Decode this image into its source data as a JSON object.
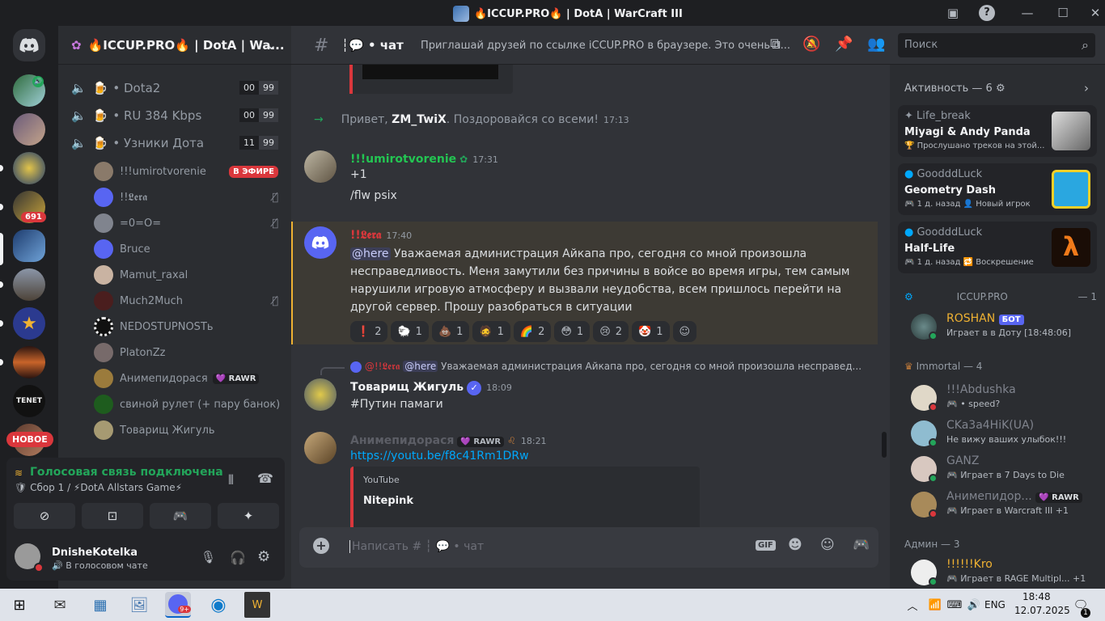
{
  "window": {
    "title": "🔥ICCUP.PRO🔥 | DotA | WarCraft III"
  },
  "colors": {
    "accent": "#5865f2",
    "live": "#da373c",
    "online": "#23a55a",
    "dnd": "#da373c",
    "mention_bg": "#3c3e57"
  },
  "guilds": {
    "badge_count": "691",
    "new_label": "НОВОЕ",
    "tenet_label": "TENET"
  },
  "server": {
    "name": "🔥ICCUP.PRO🔥 | DotA | Wa..."
  },
  "voice_channels": [
    {
      "name": "Dota2",
      "left": "00",
      "right": "99"
    },
    {
      "name": "RU 384 Kbps",
      "left": "00",
      "right": "99"
    },
    {
      "name": "Узники Дота",
      "left": "11",
      "right": "99"
    }
  ],
  "voice_users": [
    {
      "name": "!!!umirotvorenie",
      "live": "В ЭФИРЕ"
    },
    {
      "name": "!!𝕷𝖊𝖗𝖆"
    },
    {
      "name": "=0=O="
    },
    {
      "name": "Bruce"
    },
    {
      "name": "Mamut_raxal"
    },
    {
      "name": "Much2Much"
    },
    {
      "name": "NEDOSTUPNOSTь"
    },
    {
      "name": "PlatonZz"
    },
    {
      "name": "Анимепидорася",
      "tag": "RAWR"
    },
    {
      "name": "свиной рулет (+ пару банок)"
    },
    {
      "name": "Товарищ Жигуль"
    }
  ],
  "voice_panel": {
    "status": "Голосовая связь подключена",
    "channel": "Сбор 1 / ⚡DotA Allstars Game⚡"
  },
  "user_panel": {
    "name": "DnisheKotelka",
    "status": "В голосовом чате"
  },
  "chat_header": {
    "channel": "• чат",
    "topic": "Приглашай друзей по ссылке iCCUP.PRO в браузере. Это очень п...",
    "search_placeholder": "Поиск"
  },
  "system_msg": {
    "prefix": "Привет, ",
    "user": "ZM_TwiX",
    "suffix": ". Поздоровайся со всеми!",
    "time": "17:13"
  },
  "messages": [
    {
      "author": "!!!umirotvorenie",
      "time": "17:31",
      "lines": [
        "+1",
        "/flw psix"
      ]
    },
    {
      "author": "!!𝕷𝖊𝖗𝖆",
      "time": "17:40",
      "mention": "@here",
      "text": "Уважаемая администрация Айкапа про, сегодня со мной произошла несправедливость. Меня замутили без причины в войсе во время игры, тем самым нарушили игровую атмосферу и вызвали неудобства, всем пришлось перейти на другой сервер. Прошу разобраться в ситуации"
    },
    {
      "author": "Товарищ Жигуль",
      "time": "18:09",
      "reply_author": "@!!𝕷𝖊𝖗𝖆",
      "reply_mention": "@here",
      "reply_text": "Уважаемая администрация Айкапа про, сегодня со мной произошла несправед...",
      "text": "#Путин памаги"
    },
    {
      "author": "Анимепидорася",
      "tag": "RAWR",
      "time": "18:21",
      "link": "https://youtu.be/f8c41Rm1DRw",
      "embed_provider": "YouTube",
      "embed_author": "Nitepink"
    }
  ],
  "reactions": [
    {
      "emoji": "❗",
      "count": "2"
    },
    {
      "emoji": "🐑",
      "count": "1"
    },
    {
      "emoji": "💩",
      "count": "1"
    },
    {
      "emoji": "🧔",
      "count": "1"
    },
    {
      "emoji": "🌈",
      "count": "2"
    },
    {
      "emoji": "😳",
      "count": "1"
    },
    {
      "emoji": "😢",
      "count": "2"
    },
    {
      "emoji": "🤡",
      "count": "1"
    }
  ],
  "composer": {
    "placeholder": "Написать # ┆ 💬 • чат"
  },
  "activity": {
    "title": "Активность — 6",
    "cards": [
      {
        "user": "Life_break",
        "name": "Miyagi & Andy Panda",
        "sub": "🏆 Прослушано треков на этой..."
      },
      {
        "user": "GoodddLuck",
        "name": "Geometry Dash",
        "sub": "🎮 1 д. назад  👤 Новый игрок"
      },
      {
        "user": "GoodddLuck",
        "name": "Half-Life",
        "sub": "🎮 1 д. назад  🔁 Воскрешение"
      }
    ]
  },
  "member_groups": [
    {
      "title": "ICCUP.PRO",
      "count": "— 1",
      "members": [
        {
          "name": "ROSHAN",
          "bot": "БОТ",
          "activity": "Играет в в Доту [18:48:06]"
        }
      ]
    },
    {
      "title": "Immortal — 4",
      "members": [
        {
          "name": "!!!Abdushka",
          "activity": "🎮 • speed?"
        },
        {
          "name": "CKa3a4HiK(UA)",
          "activity": "Не вижу ваших улыбок!!!"
        },
        {
          "name": "GANZ",
          "activity": "🎮 Играет в 7 Days to Die"
        },
        {
          "name": "Анимепидор...",
          "tag": "RAWR",
          "activity": "🎮 Играет в Warcraft III +1"
        }
      ]
    },
    {
      "title": "Админ — 3",
      "members": [
        {
          "name": "!!!!!!Kro",
          "activity": "🎮 Играет в RAGE Multipl...",
          "extra": "+1"
        }
      ]
    }
  ],
  "taskbar": {
    "lang": "ENG",
    "time": "18:48",
    "date": "12.07.2025",
    "notif": "1"
  }
}
